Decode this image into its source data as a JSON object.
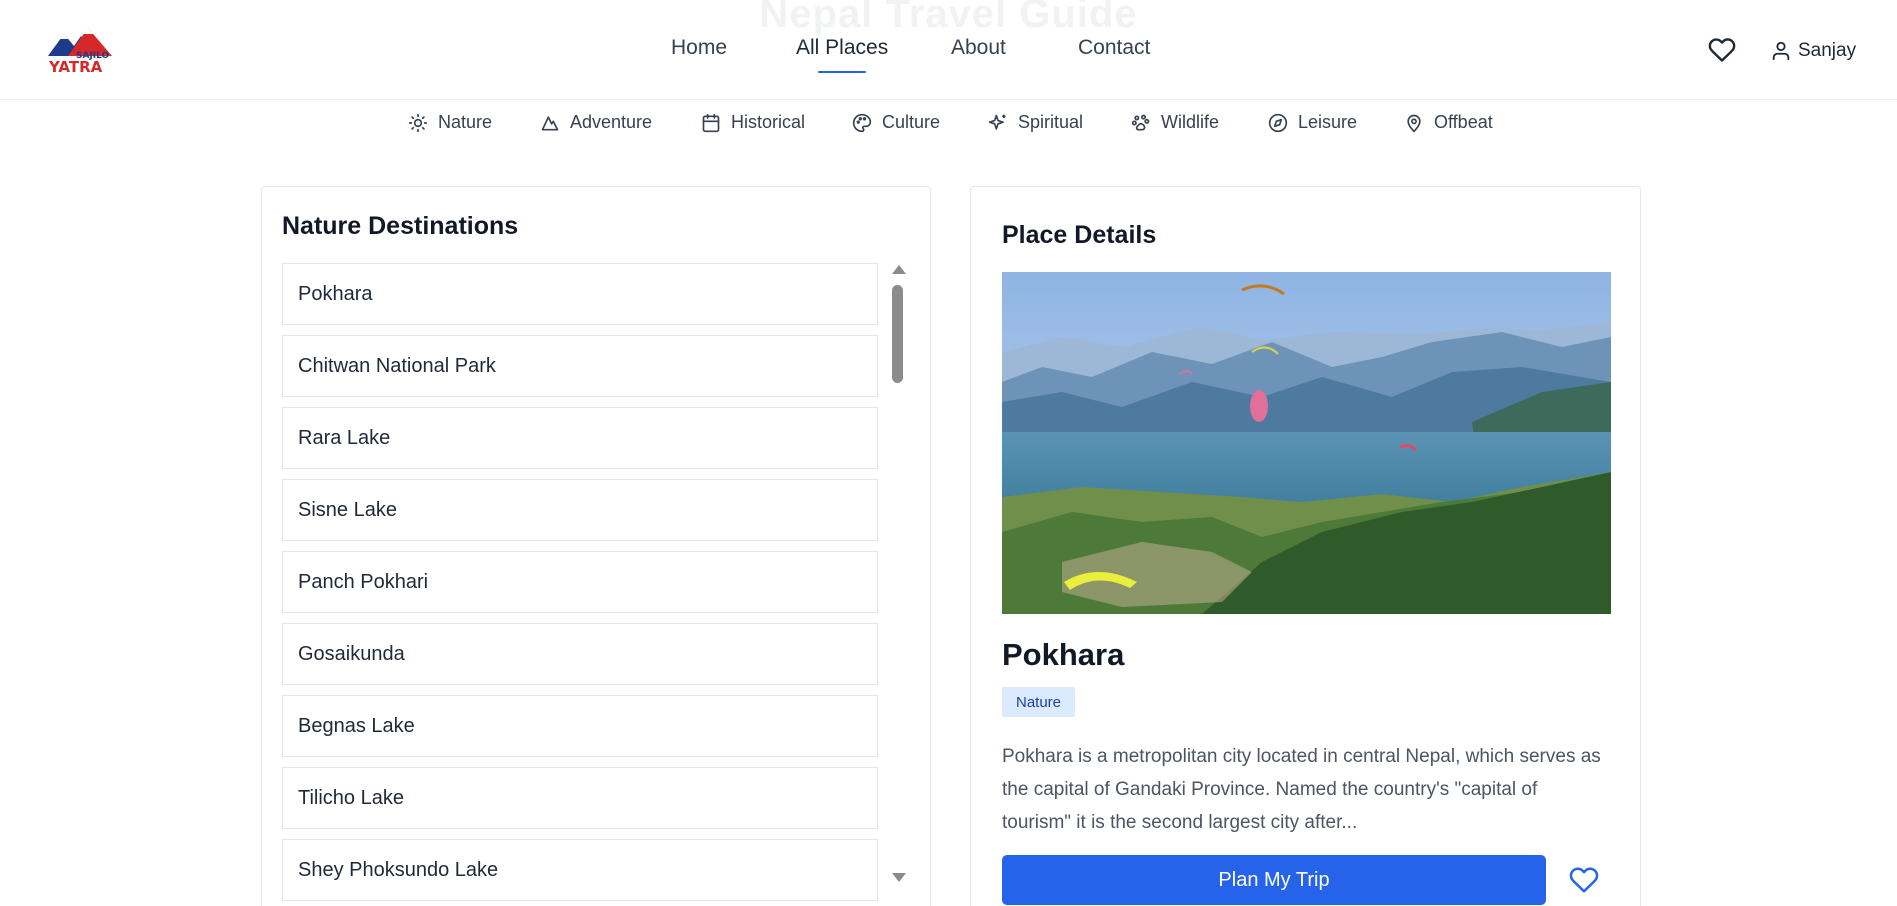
{
  "page": {
    "ghost_title": "Nepal Travel Guide"
  },
  "brand": {
    "logo_line1": "SAJILO",
    "logo_line2": "YATRA",
    "colors": {
      "red": "#d62828",
      "blue": "#1e3a8a"
    }
  },
  "nav": {
    "items": [
      {
        "label": "Home"
      },
      {
        "label": "All Places",
        "active": true
      },
      {
        "label": "About"
      },
      {
        "label": "Contact"
      }
    ],
    "favorites_icon": "heart-icon",
    "user_name": "Sanjay",
    "user_icon": "user-icon"
  },
  "categories": [
    {
      "label": "Nature",
      "icon": "sun-icon"
    },
    {
      "label": "Adventure",
      "icon": "mountain-icon"
    },
    {
      "label": "Historical",
      "icon": "calendar-icon"
    },
    {
      "label": "Culture",
      "icon": "palette-icon"
    },
    {
      "label": "Spiritual",
      "icon": "sparkles-icon"
    },
    {
      "label": "Wildlife",
      "icon": "paw-icon"
    },
    {
      "label": "Leisure",
      "icon": "compass-icon"
    },
    {
      "label": "Offbeat",
      "icon": "map-pin-icon"
    }
  ],
  "destinations": {
    "title": "Nature Destinations",
    "items": [
      "Pokhara",
      "Chitwan National Park",
      "Rara Lake",
      "Sisne Lake",
      "Panch Pokhari",
      "Gosaikunda",
      "Begnas Lake",
      "Tilicho Lake",
      "Shey Phoksundo Lake"
    ]
  },
  "details": {
    "title": "Place Details",
    "name": "Pokhara",
    "badge": "Nature",
    "description": "Pokhara is a metropolitan city located in central Nepal, which serves as the capital of Gandaki Province. Named the country's \"capital of tourism\" it is the second largest city after...",
    "plan_button": "Plan My Trip",
    "favorite_icon": "heart-icon"
  },
  "colors": {
    "accent": "#2563eb",
    "badge_bg": "#dbeafe",
    "badge_text": "#1e40af"
  }
}
